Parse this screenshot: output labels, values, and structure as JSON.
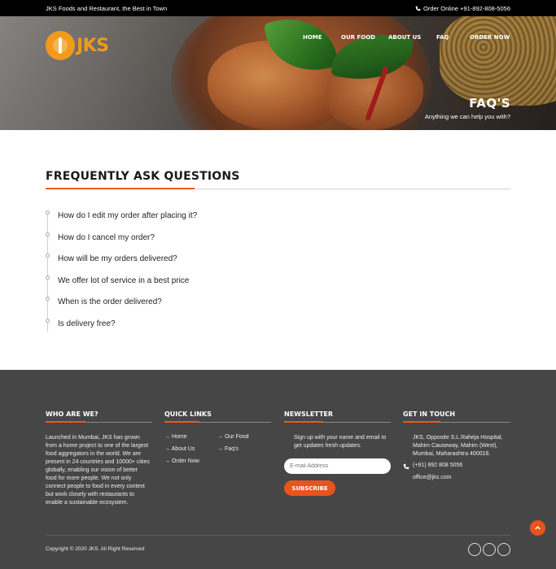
{
  "topbar": {
    "tagline": "JKS Foods and Restaurant, the Best in Town",
    "order_online": "Order Online +91-892-808-5056"
  },
  "brand": {
    "logo_text": "JKS",
    "accent": "#f29a1c"
  },
  "nav": {
    "items": [
      {
        "label": "HOME"
      },
      {
        "label": "OUR FOOD"
      },
      {
        "label": "ABOUT US"
      },
      {
        "label": "FAQ"
      },
      {
        "label": "ORDER NOW"
      }
    ]
  },
  "hero": {
    "title": "FAQ'S",
    "subtitle": "Anything we can help you with?"
  },
  "faq": {
    "heading": "FREQUENTLY ASK QUESTIONS",
    "questions": [
      "How do I edit my order after placing it?",
      "How do I cancel my order?",
      "How will be my orders delivered?",
      "We offer lot of service in a best price",
      "When is the order delivered?",
      "Is delivery free?"
    ]
  },
  "footer": {
    "background": "#464646",
    "accent": "#e8541c",
    "who": {
      "title": "WHO ARE WE?",
      "text": "Launched in Mumbai, JKS has grown from a home project to one of the largest food aggregators in the world. We are present in 24 countries and 10000+ cities globally, enabling our vision of better food for more people. We not only connect people to food in every context but work closely with restaurants to enable a sustainable ecosystem."
    },
    "quick_links": {
      "title": "QUICK LINKS",
      "items": [
        "Home",
        "Our Food",
        "About Us",
        "Faq's",
        "Order Now"
      ]
    },
    "newsletter": {
      "title": "NEWSLETTER",
      "text": "Sign up with your name and email to get updates fresh updates.",
      "email_placeholder": "E-mail Address",
      "button": "SUBSCRIBE"
    },
    "contact": {
      "title": "GET IN TOUCH",
      "address": "JKS, Opposite S.L.Raheja Hospital, Mahim Causeway, Mahim (West), Mumbai, Maharashtra 400016.",
      "phone": "(+91) 892 808 5056",
      "email": "office@jks.com"
    },
    "copyright": "Copyright © 2020 JKS. All Right Reserved",
    "social_icons": [
      "social-icon-1",
      "social-icon-2",
      "social-icon-3"
    ],
    "back_to_top_icon": "chevron-up-icon"
  }
}
